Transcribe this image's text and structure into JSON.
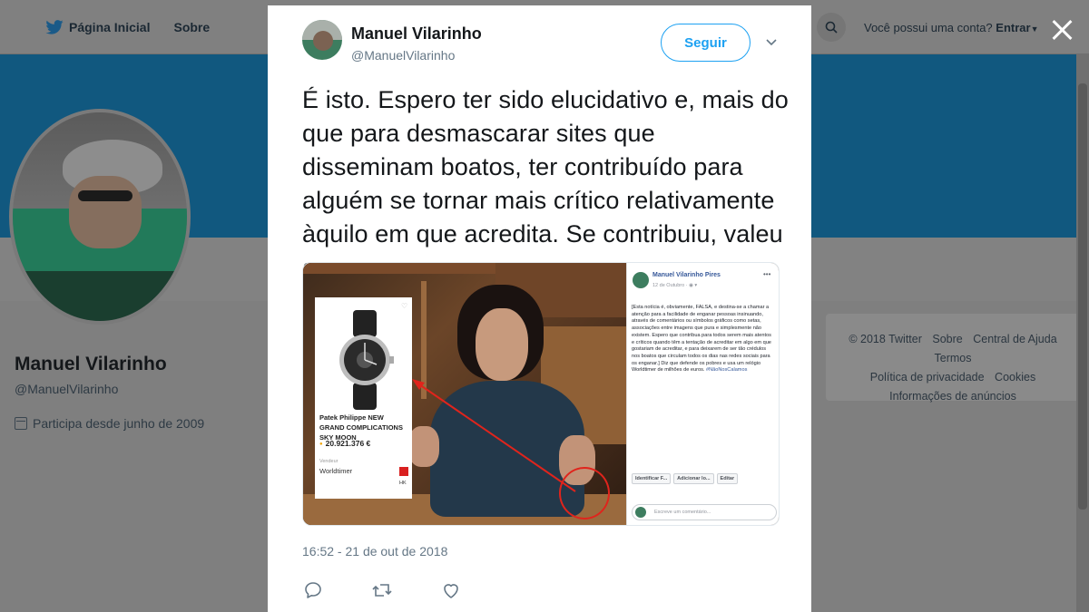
{
  "topnav": {
    "home_label": "Página Inicial",
    "about_label": "Sobre"
  },
  "topright": {
    "account_prompt": "Você possui uma conta?",
    "login_label": "Entrar"
  },
  "profile": {
    "name": "Manuel Vilarinho",
    "handle": "@ManuelVilarinho",
    "joined": "Participa desde junho de 2009"
  },
  "footer": {
    "copyright": "© 2018 Twitter",
    "about": "Sobre",
    "help": "Central de Ajuda",
    "terms": "Termos",
    "privacy": "Política de privacidade",
    "cookies": "Cookies",
    "ads": "Informações de anúncios"
  },
  "tweet": {
    "author_name": "Manuel Vilarinho",
    "author_handle": "@ManuelVilarinho",
    "follow_label": "Seguir",
    "text": "É isto. Espero ter sido elucidativo e, mais do que para desmascarar sites que disseminam boatos, ter contribuído para alguém se tornar mais crítico relativamente àquilo em que acredita. Se contribuiu, valeu a pena.",
    "timestamp": "16:52 - 21 de out de 2018"
  },
  "media": {
    "watch": {
      "title": "Patek Philippe NEW GRAND COMPLICATIONS SKY MOON",
      "price": "20.921.376 €",
      "seller_label": "Vendeur",
      "seller": "Worldtimer",
      "region": "HK"
    },
    "fb": {
      "name": "Manuel Vilarinho Pires",
      "date": "12 de Outubro · ",
      "text": "[Esta notícia é, obviamente, FALSA, e destina-se a chamar a atenção para a facilidade de enganar pessoas insinuando, através de comentários ou símbolos gráficos como setas, associações entre imagens que pura e simplesmente não existem. Espero que contribua para todos serem mais atentos e críticos quando têm a tentação de acreditar em algo em que gostariam de acreditar, e para deixarem de ser tão crédulos nos boatos que circulam todos os dias nas redes sociais para os enganar.] Diz que defende os pobres e usa um relógio Worldtimer de milhões de euros.",
      "hashtag": "#NãoNosCalamos",
      "action_tag": "Identificar F...",
      "action_location": "Adicionar lo...",
      "action_edit": "Editar",
      "comment_placeholder": "Escreve um comentário..."
    }
  },
  "colors": {
    "accent": "#1da1f2",
    "banner": "#11587f",
    "arrow": "#e0241c"
  },
  "icons": [
    "twitter-bird-icon",
    "search-icon",
    "close-icon",
    "chevron-down-icon",
    "calendar-icon",
    "reply-icon",
    "retweet-icon",
    "like-icon"
  ]
}
